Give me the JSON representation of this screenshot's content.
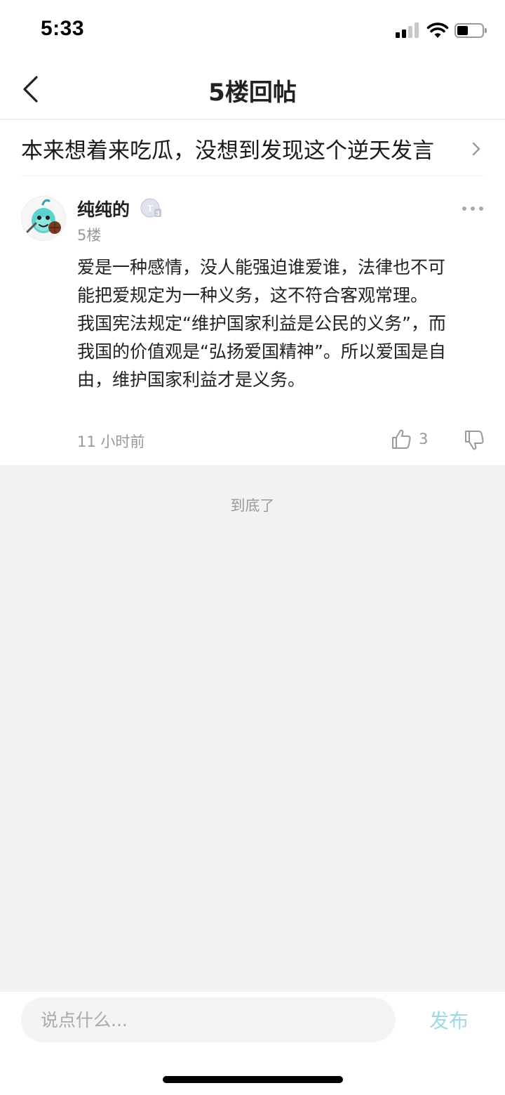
{
  "status_bar": {
    "time": "5:33"
  },
  "nav": {
    "title": "5楼回帖"
  },
  "thread": {
    "title": "本来想着来吃瓜，没想到发现这个逆天发言"
  },
  "post": {
    "username": "纯纯的",
    "level_badge": "T3",
    "floor": "5楼",
    "content_lines": [
      "爱是一种感情，没人能强迫谁爱谁，法律也不可",
      "能把爱规定为一种义务，这不符合客观常理。",
      "我国宪法规定“维护国家利益是公民的义务”，而",
      "我国的价值观是“弘扬爱国精神”。所以爱国是自",
      "由，维护国家利益才是义务。"
    ],
    "time": "11 小时前",
    "like_count": "3"
  },
  "end_text": "到底了",
  "comment_bar": {
    "placeholder": "说点什么...",
    "publish_label": "发布"
  },
  "colors": {
    "accent": "#9ed9e8",
    "page_background": "#f2f2f2",
    "secondary_text": "#999999"
  },
  "icons": [
    "back-arrow",
    "chevron-right",
    "more-dots",
    "thumbs-up",
    "thumbs-down",
    "signal",
    "wifi",
    "battery"
  ]
}
